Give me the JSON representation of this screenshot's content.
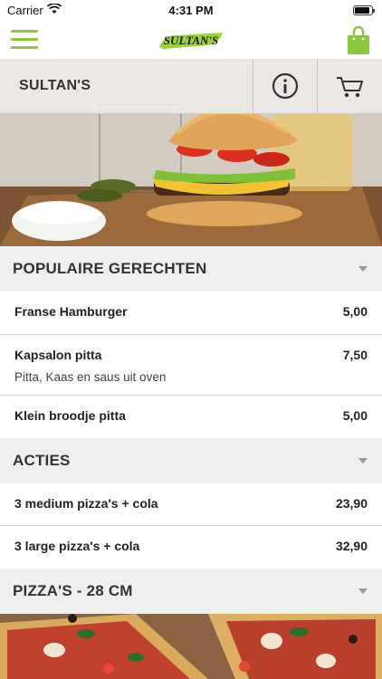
{
  "status_bar": {
    "carrier": "Carrier",
    "time": "4:31 PM"
  },
  "nav": {
    "logo_text": "SULTAN'S",
    "menu_icon": "hamburger-menu-icon",
    "bag_icon": "shopping-bag-icon"
  },
  "hero": {
    "shop_name": "SULTAN'S",
    "info_icon": "info-icon",
    "cart_icon": "cart-icon"
  },
  "sections": [
    {
      "title": "POPULAIRE GERECHTEN",
      "items": [
        {
          "name": "Franse Hamburger",
          "price": "5,00",
          "description": ""
        },
        {
          "name": "Kapsalon pitta",
          "price": "7,50",
          "description": "Pitta, Kaas en saus uit oven"
        },
        {
          "name": "Klein broodje pitta",
          "price": "5,00",
          "description": ""
        }
      ]
    },
    {
      "title": "ACTIES",
      "items": [
        {
          "name": "3 medium pizza's + cola",
          "price": "23,90",
          "description": ""
        },
        {
          "name": "3 large pizza's + cola",
          "price": "32,90",
          "description": ""
        }
      ]
    },
    {
      "title": "PIZZA'S - 28 CM",
      "items": []
    }
  ],
  "colors": {
    "accent": "#8cc63f",
    "section_bg": "#efefef",
    "text": "#222222"
  }
}
